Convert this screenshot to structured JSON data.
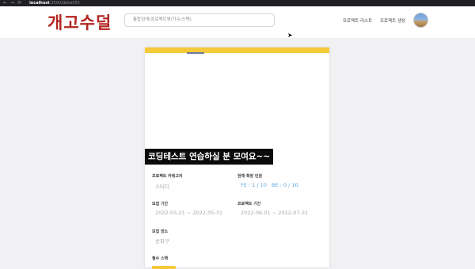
{
  "browser": {
    "back_icon": "arrow-left-icon",
    "forward_icon": "arrow-right-icon",
    "reload_icon": "reload-icon",
    "url_host": "localhost",
    "url_rest": ":3000/detail/55"
  },
  "header": {
    "logo": "개고수덜",
    "search_placeholder": "통합검색(프로젝트명/기수/스택)",
    "nav": [
      "프로젝트 리스트",
      "프로젝트 생성"
    ]
  },
  "card": {
    "title": "코딩테스트 연습하실 분 모여요~~",
    "fields": {
      "category_label": "프로젝트 카테고리",
      "category_value": "스터디",
      "members_label": "현재 확정 인원",
      "members_fe": "FE : 1 / 10",
      "members_be": "BE : 0 / 10",
      "recruit_label": "모집 기간",
      "recruit_value": "2022-05-21 ~ 2022-05-31",
      "project_period_label": "프로젝트 기간",
      "project_period_value": "2022-06-01 ~ 2022-07-31",
      "location_label": "모집 장소",
      "location_value": "송파구",
      "skills_label": "필수 스택"
    }
  },
  "colors": {
    "brand_red": "#b2241f",
    "accent_yellow": "#f6c93b",
    "link_blue": "#5aa7df"
  }
}
